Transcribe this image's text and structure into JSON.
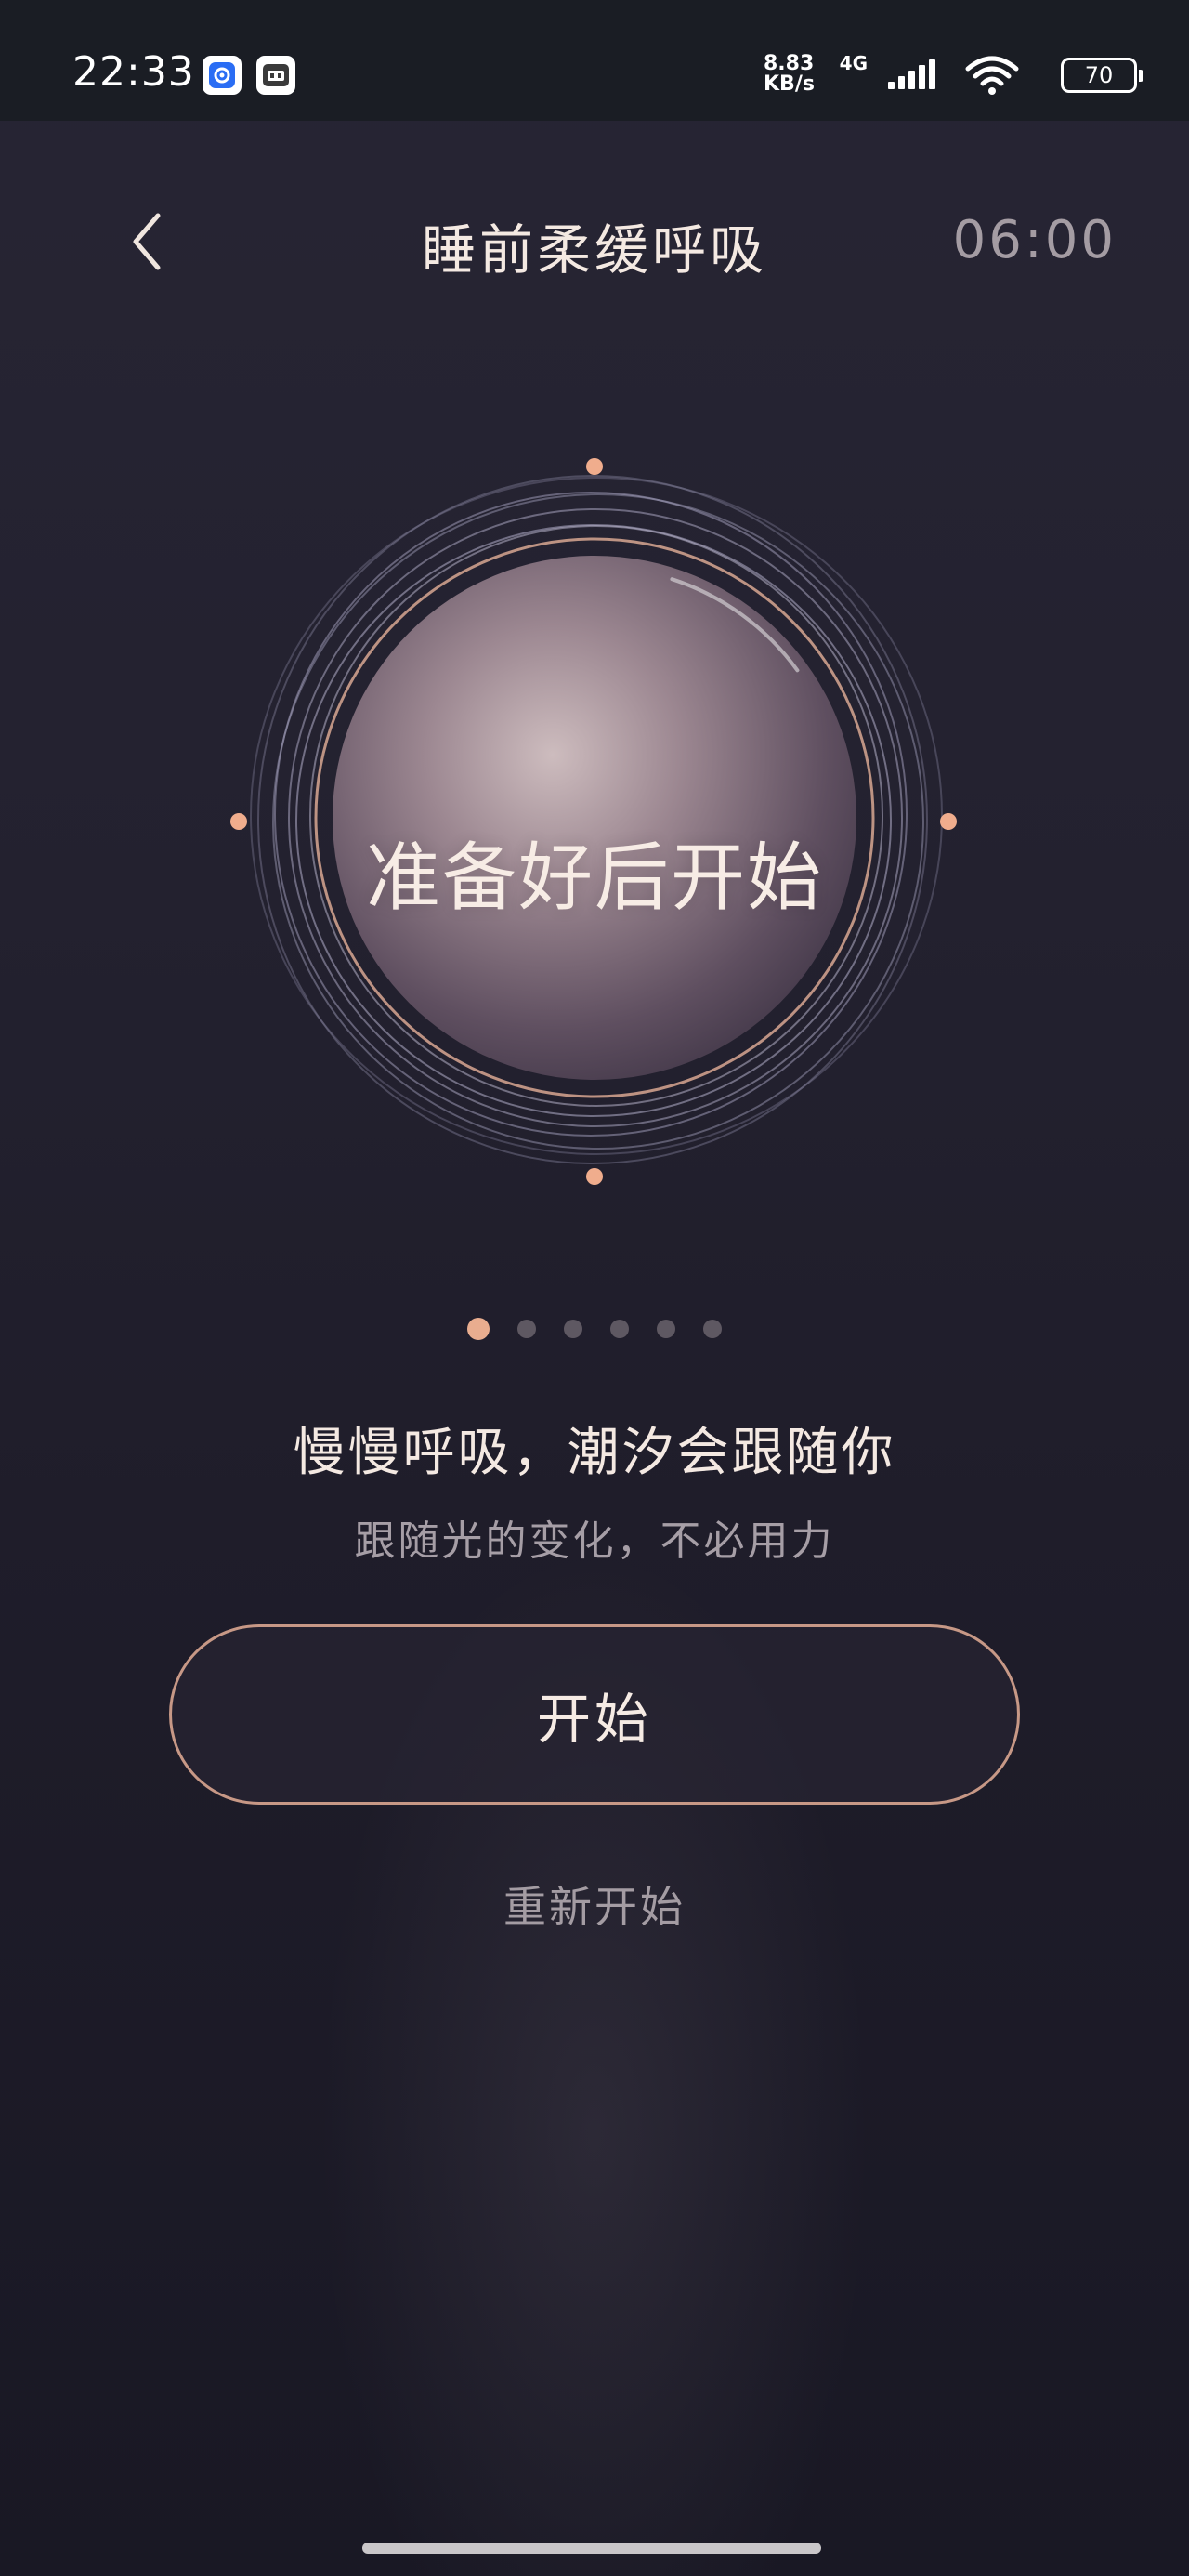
{
  "status_bar": {
    "time": "22:33",
    "net_speed_value": "8.83",
    "net_speed_unit": "KB/s",
    "network_type": "4G",
    "battery": "70"
  },
  "header": {
    "title": "睡前柔缓呼吸",
    "timer": "06:00"
  },
  "orb": {
    "label": "准备好后开始",
    "progress_fraction": 0.1
  },
  "pager": {
    "count": 6,
    "active_index": 0
  },
  "message": {
    "headline": "慢慢呼吸，潮汐会跟随你",
    "subline": "跟随光的变化，不必用力"
  },
  "actions": {
    "start_label": "开始",
    "restart_label": "重新开始"
  },
  "colors": {
    "accent": "#e9ad8f",
    "background": "#23212f",
    "orb_center": "#cdbcbe"
  }
}
